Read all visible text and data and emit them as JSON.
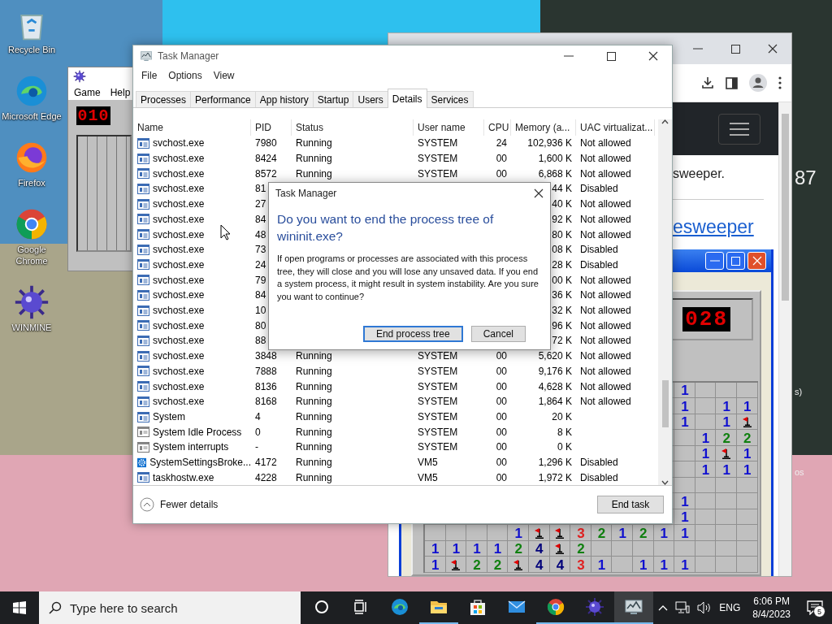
{
  "desktop_icons": [
    {
      "kind": "recycle-bin",
      "label": "Recycle Bin"
    },
    {
      "kind": "edge",
      "label": "Microsoft Edge"
    },
    {
      "kind": "firefox",
      "label": "Firefox"
    },
    {
      "kind": "chrome",
      "label": "Google Chrome"
    },
    {
      "kind": "mine",
      "label": "WINMINE"
    }
  ],
  "minesweeper_back": {
    "menu": [
      "Game",
      "Help"
    ],
    "counter": "010"
  },
  "browser": {
    "text": "sweeper.",
    "link": "esweeper",
    "game": {
      "counter": "028",
      "rows": [
        [
          "",
          "",
          "",
          "",
          "",
          "",
          "",
          "",
          "",
          "",
          "",
          "",
          "1",
          "",
          "",
          ""
        ],
        [
          "",
          "",
          "",
          "",
          "",
          "",
          "",
          "",
          "",
          "",
          "",
          "",
          "1",
          "",
          "1",
          "1"
        ],
        [
          "",
          "",
          "",
          "",
          "",
          "",
          "",
          "",
          "",
          "",
          "",
          "",
          "1",
          "",
          "1",
          {
            "kind": "flag"
          }
        ],
        [
          "",
          "",
          "",
          "",
          "",
          "",
          "",
          "",
          "",
          "",
          "",
          "",
          "",
          "1",
          "2",
          "2"
        ],
        [
          "",
          "",
          "",
          "",
          "",
          "",
          "",
          "",
          "",
          "",
          "",
          "",
          "",
          "1",
          {
            "kind": "flag"
          },
          "1"
        ],
        [
          "",
          "",
          "",
          "",
          "",
          "",
          "",
          "",
          "",
          "",
          "",
          "",
          "",
          "1",
          "1",
          "1"
        ],
        [
          "",
          "",
          "",
          "",
          "",
          "",
          "",
          "",
          "",
          "",
          "",
          "",
          "",
          "",
          "",
          ""
        ],
        [
          "",
          "",
          "",
          "",
          "",
          "",
          "",
          "",
          "",
          "",
          "",
          "",
          "1",
          "",
          "",
          ""
        ],
        [
          "",
          "",
          "",
          "",
          "",
          "",
          "",
          "",
          "",
          "",
          "",
          "",
          "1",
          "",
          "",
          ""
        ],
        [
          "",
          "",
          "",
          "",
          "1",
          {
            "kind": "flag"
          },
          {
            "kind": "flag"
          },
          "3",
          "2",
          "1",
          "2",
          "1",
          "1",
          "",
          "",
          ""
        ],
        [
          "1",
          "1",
          "1",
          "1",
          "2",
          "4",
          {
            "kind": "flag"
          },
          "2",
          "",
          "",
          "",
          "",
          "",
          "",
          "",
          ""
        ],
        [
          "1",
          {
            "kind": "flag"
          },
          "2",
          "2",
          {
            "kind": "flag"
          },
          "4",
          "4",
          "3",
          "1",
          "",
          "1",
          "1",
          "1",
          "",
          "",
          ""
        ]
      ]
    }
  },
  "background_fragments": [
    "87",
    "s)",
    "os"
  ],
  "task_manager": {
    "title": "Task Manager",
    "menu": [
      "File",
      "Options",
      "View"
    ],
    "tabs": [
      {
        "label": "Processes",
        "selected": false
      },
      {
        "label": "Performance",
        "selected": false
      },
      {
        "label": "App history",
        "selected": false
      },
      {
        "label": "Startup",
        "selected": false
      },
      {
        "label": "Users",
        "selected": false
      },
      {
        "label": "Details",
        "selected": true
      },
      {
        "label": "Services",
        "selected": false
      }
    ],
    "columns": [
      "Name",
      "PID",
      "Status",
      "User name",
      "CPU",
      "Memory (a...",
      "UAC virtualizat..."
    ],
    "rows": [
      {
        "kind": "service",
        "name": "svchost.exe",
        "pid": "7980",
        "status": "Running",
        "user": "SYSTEM",
        "cpu": "24",
        "memory": "102,936 K",
        "uac": "Not allowed"
      },
      {
        "kind": "service",
        "name": "svchost.exe",
        "pid": "8424",
        "status": "Running",
        "user": "SYSTEM",
        "cpu": "00",
        "memory": "1,600 K",
        "uac": "Not allowed"
      },
      {
        "kind": "service",
        "name": "svchost.exe",
        "pid": "8572",
        "status": "Running",
        "user": "SYSTEM",
        "cpu": "00",
        "memory": "6,868 K",
        "uac": "Not allowed"
      },
      {
        "kind": "service",
        "name": "svchost.exe",
        "pid": "81",
        "memory": "44 K",
        "uac": "Disabled"
      },
      {
        "kind": "service",
        "name": "svchost.exe",
        "pid": "27",
        "memory": "40 K",
        "uac": "Not allowed"
      },
      {
        "kind": "service",
        "name": "svchost.exe",
        "pid": "84",
        "memory": "92 K",
        "uac": "Not allowed"
      },
      {
        "kind": "service",
        "name": "svchost.exe",
        "pid": "48",
        "memory": "80 K",
        "uac": "Not allowed"
      },
      {
        "kind": "service",
        "name": "svchost.exe",
        "pid": "73",
        "memory": "08 K",
        "uac": "Disabled"
      },
      {
        "kind": "service",
        "name": "svchost.exe",
        "pid": "24",
        "memory": "28 K",
        "uac": "Disabled"
      },
      {
        "kind": "service",
        "name": "svchost.exe",
        "pid": "79",
        "memory": "00 K",
        "uac": "Not allowed"
      },
      {
        "kind": "service",
        "name": "svchost.exe",
        "pid": "84",
        "memory": "36 K",
        "uac": "Not allowed"
      },
      {
        "kind": "service",
        "name": "svchost.exe",
        "pid": "10",
        "memory": "32 K",
        "uac": "Not allowed"
      },
      {
        "kind": "service",
        "name": "svchost.exe",
        "pid": "80",
        "memory": "96 K",
        "uac": "Not allowed"
      },
      {
        "kind": "service",
        "name": "svchost.exe",
        "pid": "88",
        "memory": "72 K",
        "uac": "Not allowed"
      },
      {
        "kind": "service",
        "name": "svchost.exe",
        "pid": "3848",
        "status": "Running",
        "user": "SYSTEM",
        "cpu": "00",
        "memory": "5,620 K",
        "uac": "Not allowed"
      },
      {
        "kind": "service",
        "name": "svchost.exe",
        "pid": "7888",
        "status": "Running",
        "user": "SYSTEM",
        "cpu": "00",
        "memory": "9,176 K",
        "uac": "Not allowed"
      },
      {
        "kind": "service",
        "name": "svchost.exe",
        "pid": "8136",
        "status": "Running",
        "user": "SYSTEM",
        "cpu": "00",
        "memory": "4,628 K",
        "uac": "Not allowed"
      },
      {
        "kind": "service",
        "name": "svchost.exe",
        "pid": "8168",
        "status": "Running",
        "user": "SYSTEM",
        "cpu": "00",
        "memory": "1,864 K",
        "uac": "Not allowed"
      },
      {
        "kind": "service",
        "name": "System",
        "pid": "4",
        "status": "Running",
        "user": "SYSTEM",
        "cpu": "00",
        "memory": "20 K"
      },
      {
        "kind": "system",
        "name": "System Idle Process",
        "pid": "0",
        "status": "Running",
        "user": "SYSTEM",
        "cpu": "00",
        "memory": "8 K"
      },
      {
        "kind": "system",
        "name": "System interrupts",
        "pid": "-",
        "status": "Running",
        "user": "SYSTEM",
        "cpu": "00",
        "memory": "0 K"
      },
      {
        "kind": "settings",
        "name": "SystemSettingsBroke...",
        "pid": "4172",
        "status": "Running",
        "user": "VM5",
        "cpu": "00",
        "memory": "1,296 K",
        "uac": "Disabled"
      },
      {
        "kind": "service",
        "name": "taskhostw.exe",
        "pid": "4228",
        "status": "Running",
        "user": "VM5",
        "cpu": "00",
        "memory": "1,972 K",
        "uac": "Disabled"
      }
    ],
    "fewer_details": "Fewer details",
    "end_task": "End task"
  },
  "dialog": {
    "title": "Task Manager",
    "heading": "Do you want to end the process tree of wininit.exe?",
    "message": "If open programs or processes are associated with this process tree, they will close and you will lose any unsaved data. If you end a system process, it might result in system instability. Are you sure you want to continue?",
    "buttons": [
      {
        "label": "End process tree",
        "selected": true
      },
      {
        "label": "Cancel",
        "selected": false
      }
    ]
  },
  "taskbar": {
    "search_placeholder": "Type here to search",
    "apps": [
      {
        "kind": "cortana",
        "running": false,
        "active": false
      },
      {
        "kind": "task-view",
        "running": false,
        "active": false
      },
      {
        "kind": "edge",
        "running": false,
        "active": false
      },
      {
        "kind": "explorer",
        "running": true,
        "active": false
      },
      {
        "kind": "store",
        "running": false,
        "active": false
      },
      {
        "kind": "mail",
        "running": false,
        "active": false
      },
      {
        "kind": "chrome",
        "running": true,
        "active": false
      },
      {
        "kind": "mine",
        "running": true,
        "active": false
      },
      {
        "kind": "task-manager",
        "running": true,
        "active": true
      }
    ],
    "language": "ENG",
    "time": "6:06 PM",
    "date": "8/4/2023",
    "notifications": "5"
  }
}
